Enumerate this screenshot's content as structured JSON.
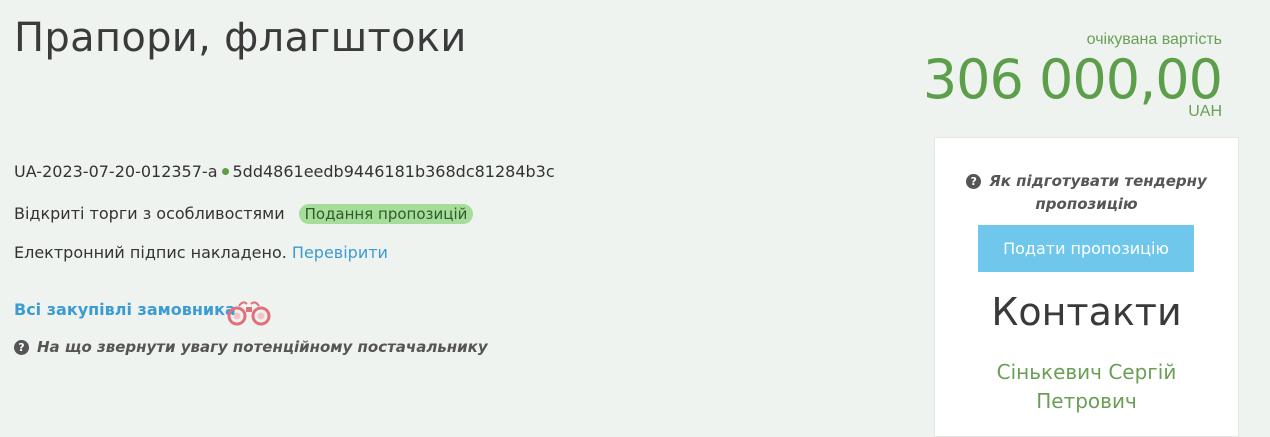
{
  "page": {
    "title": "Прапори, флагштоки"
  },
  "price": {
    "label": "очікувана вартість",
    "value": "306 000,00",
    "currency": "UAH"
  },
  "tender": {
    "id": "UA-2023-07-20-012357-a",
    "hash": "5dd4861eedb9446181b368dc81284b3c",
    "type": "Відкриті торги з особливостями",
    "status": "Подання пропозицій",
    "signature_text": "Електронний підпис накладено.",
    "verify_link": "Перевірити"
  },
  "links": {
    "all_procurements": "Всі закупівлі замовника",
    "supplier_help": "На що звернути увагу потенційному постачальнику"
  },
  "sidebar": {
    "help": "Як підготувати тендерну пропозицію",
    "submit_button": "Подати пропозицію",
    "contacts_title": "Контакти",
    "contact_name_line1": "Сінькевич Сергій",
    "contact_name_line2": "Петрович"
  },
  "colors": {
    "accent_green": "#5c9e4a",
    "link_blue": "#3c9bd3",
    "button_blue": "#6fc8ec",
    "badge_green": "#a5dd9b"
  }
}
